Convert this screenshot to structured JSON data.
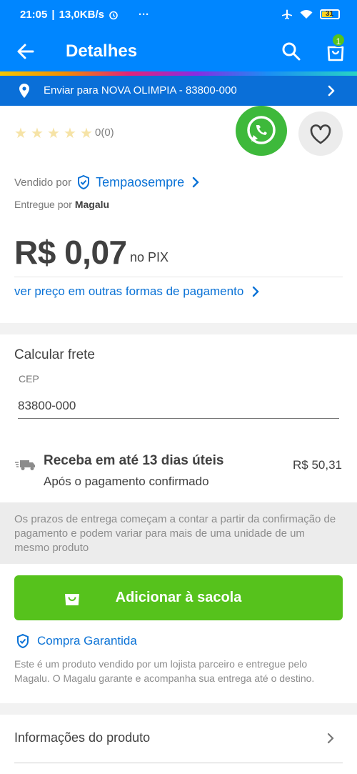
{
  "status_bar": {
    "time": "21:05",
    "network_speed": "13,0KB/s",
    "more": "···",
    "battery_level": "31"
  },
  "app_bar": {
    "title": "Detalhes",
    "cart_count": "1"
  },
  "shipping_bar": {
    "text": "Enviar para NOVA OLIMPIA - 83800-000"
  },
  "product": {
    "rating_count": "0(0)",
    "stars": 5,
    "sold_by_label": "Vendido por",
    "seller": "Tempaosempre",
    "delivered_by_label": "Entregue por",
    "delivered_by": "Magalu",
    "price": "R$ 0,07",
    "price_suffix": "no PIX",
    "other_payments": "ver preço em outras formas de pagamento"
  },
  "freight": {
    "title": "Calcular frete",
    "cep_label": "CEP",
    "cep_value": "83800-000",
    "delivery_title": "Receba em até 13 dias úteis",
    "delivery_subtitle": "Após o pagamento confirmado",
    "delivery_price": "R$ 50,31"
  },
  "notice": {
    "text": "Os prazos de entrega começam a contar a partir da confirmação de pagamento e podem variar para mais de uma unidade de um mesmo produto"
  },
  "purchase": {
    "add_to_bag": "Adicionar à sacola",
    "guarantee_title": "Compra Garantida",
    "guarantee_text": "Este é um produto vendido por um lojista parceiro e entregue pelo Magalu. O Magalu garante e acompanha sua entrega até o destino."
  },
  "product_info": {
    "label": "Informações do produto"
  },
  "colors": {
    "brand_blue": "#0086ff",
    "ship_blue": "#0a6fd8",
    "accent_green": "#56c21c",
    "whatsapp_green": "#3eb93b",
    "link_blue": "#0a72d6"
  },
  "icons": [
    "back-arrow-icon",
    "search-icon",
    "shopping-bag-icon",
    "location-pin-icon",
    "chevron-right-icon",
    "star-icon",
    "whatsapp-icon",
    "heart-icon",
    "shield-check-icon",
    "truck-icon"
  ]
}
